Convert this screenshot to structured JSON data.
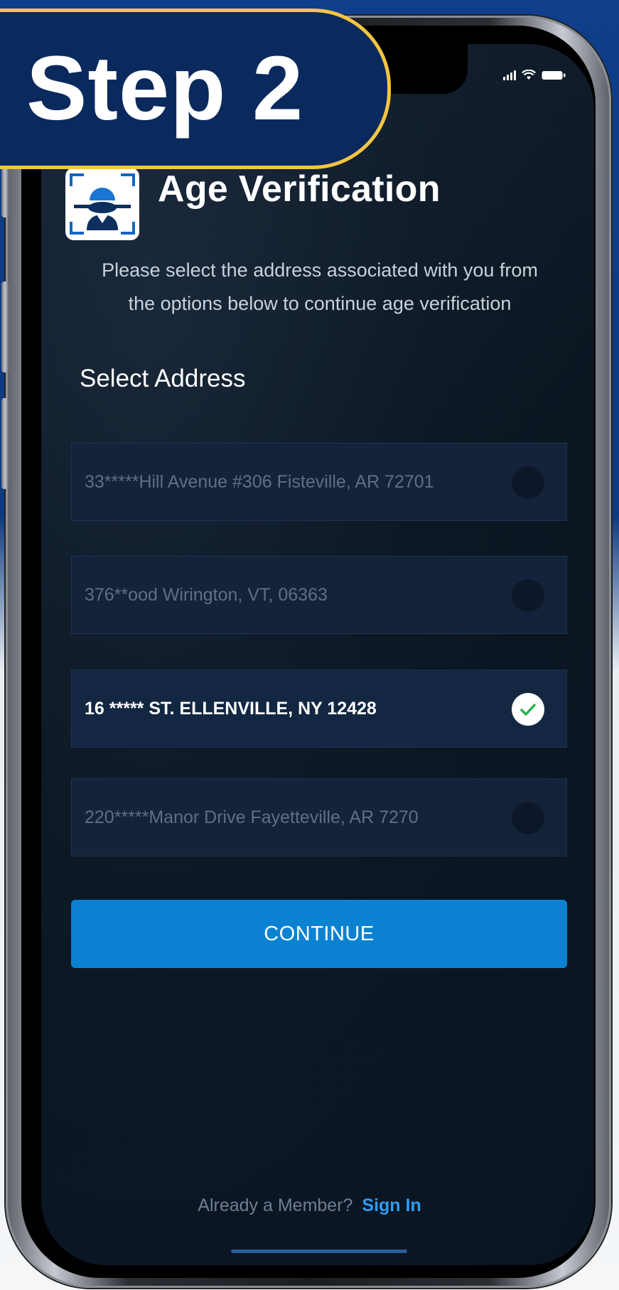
{
  "badge": {
    "text": "Step 2"
  },
  "header": {
    "title": "Age Verification",
    "instruction": "Please select the address associated with you from the options below to continue age verification"
  },
  "address_section": {
    "label": "Select Address",
    "options": [
      {
        "text": "33*****Hill Avenue #306 Fisteville, AR 72701",
        "selected": false
      },
      {
        "text": "376**ood Wirington, VT, 06363",
        "selected": false
      },
      {
        "text": "16 ***** ST. ELLENVILLE, NY 12428",
        "selected": true
      },
      {
        "text": "220*****Manor Drive Fayetteville, AR 7270",
        "selected": false
      }
    ]
  },
  "actions": {
    "continue_label": "CONTINUE"
  },
  "footer": {
    "member_text": "Already a Member?",
    "signin_label": "Sign In"
  },
  "icons": {
    "status": [
      "signal-icon",
      "wifi-icon",
      "battery-icon"
    ],
    "logo": "age-verification-logo-icon",
    "check": "checkmark-icon"
  },
  "colors": {
    "badge_background": "#0a2a5e",
    "badge_border": "#f4c542",
    "primary_button": "#0a82d1",
    "link": "#2f9cf0",
    "check": "#2db24a",
    "screen_background": "#0d1824"
  }
}
